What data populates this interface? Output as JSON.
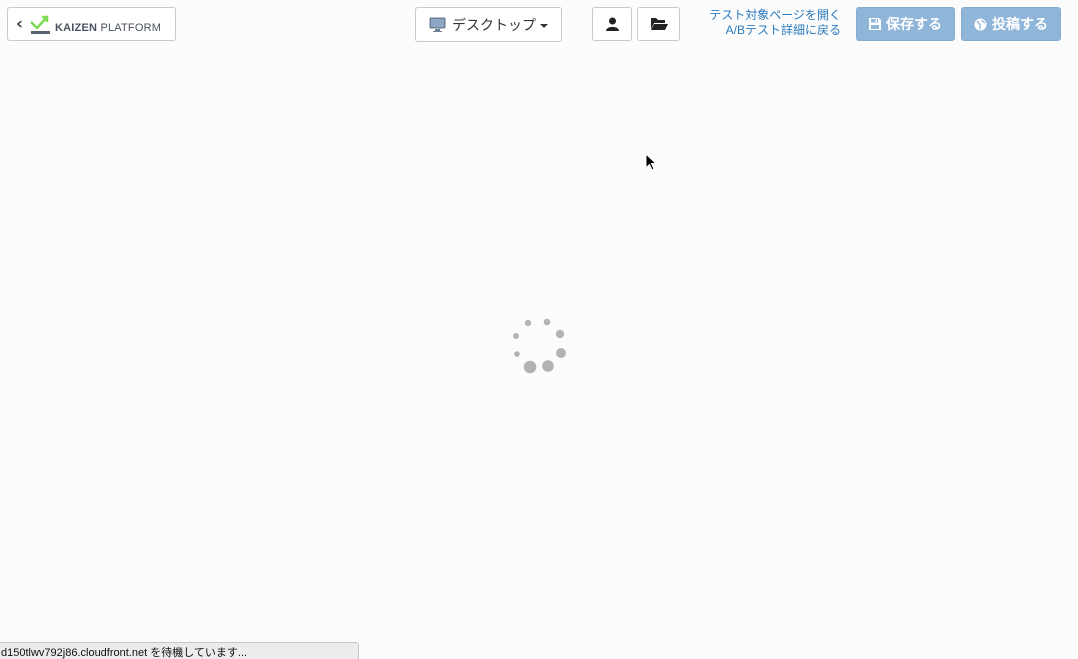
{
  "header": {
    "logo": {
      "text_bold": "KAIZEN",
      "text_regular": "PLATFORM",
      "icon": "chevron-left-icon",
      "mark_colors": [
        "#7ed957",
        "#5a6272"
      ]
    },
    "device_select": {
      "label": "デスクトップ",
      "icon": "desktop-monitor-icon"
    },
    "user_button": {
      "icon": "user-icon"
    },
    "folder_button": {
      "icon": "folder-open-icon"
    },
    "links": {
      "open_page": "テスト対象ページを開く",
      "back_to_ab": "A/Bテスト詳細に戻る"
    },
    "save_button": {
      "label": "保存する",
      "icon": "floppy-disk-icon"
    },
    "post_button": {
      "label": "投稿する",
      "icon": "globe-icon"
    }
  },
  "main": {
    "spinner": {
      "icon": "loading-spinner-icon"
    }
  },
  "status_bar": {
    "text": "d150tlwv792j86.cloudfront.net を待機しています..."
  },
  "colors": {
    "accent": "#2b7bbf",
    "action_button_bg": "#8fb5d8",
    "logo_green": "#7ed957",
    "logo_gray": "#5a6272",
    "spinner": "#b3b3b3"
  }
}
